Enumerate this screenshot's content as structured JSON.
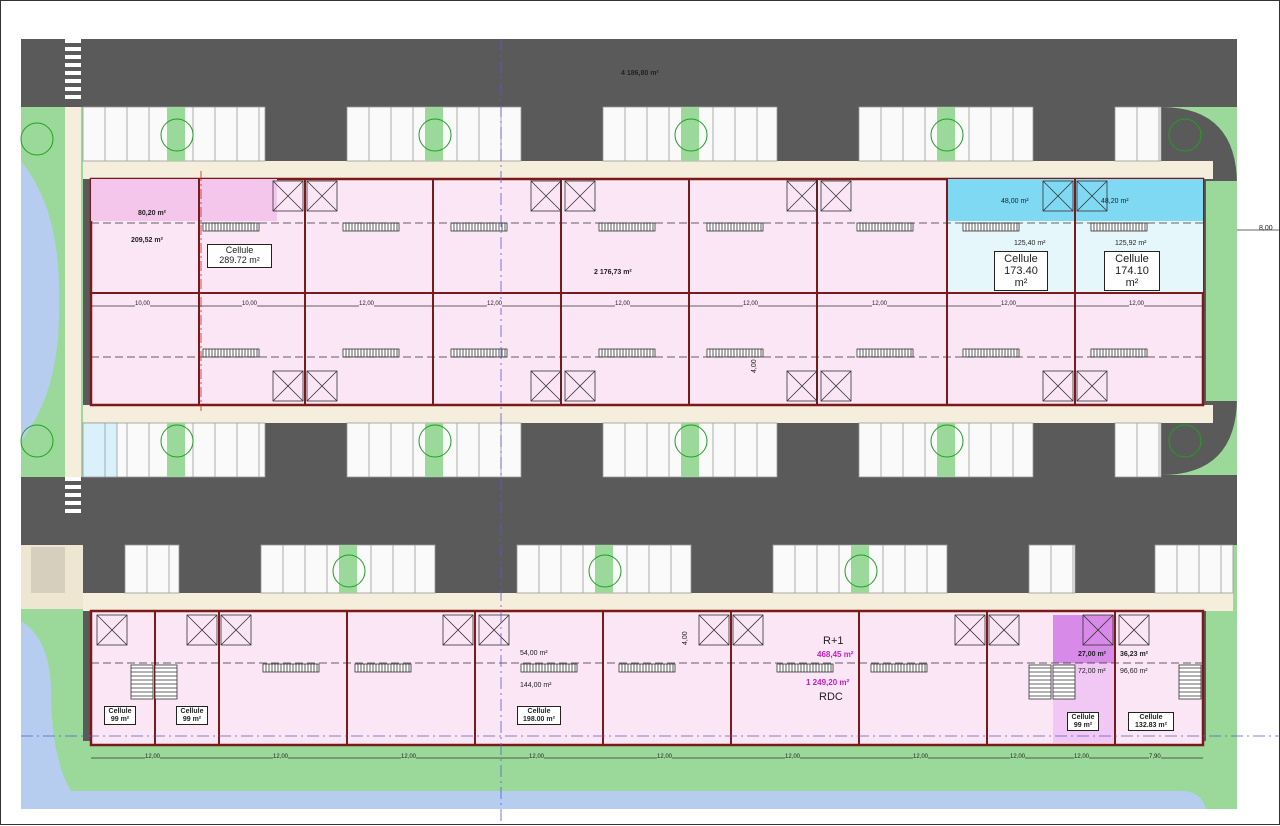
{
  "total_area": "4 186,80 m²",
  "block1": {
    "area_80": "80,20 m²",
    "area_209": "209,52 m²",
    "cell_a": {
      "label": "Cellule",
      "area": "289.72 m²"
    },
    "area_2176": "2 176,73 m²",
    "cell_b": {
      "upper": "48,00 m²",
      "ground": "125,40 m²",
      "label": "Cellule",
      "area": "173.40 m²"
    },
    "cell_c": {
      "upper": "48,20 m²",
      "ground": "125,92 m²",
      "label": "Cellule",
      "area": "174.10 m²"
    },
    "dims": [
      "10,00",
      "10,00",
      "12,00",
      "12,00",
      "12,00",
      "12,00",
      "12,00",
      "12,00",
      "12,00"
    ],
    "side_dim": "8,00",
    "stair_dim": "4,00"
  },
  "block2": {
    "cell_1": {
      "label": "Cellule",
      "area": "99 m²"
    },
    "cell_2": {
      "label": "Cellule",
      "area": "99 m²"
    },
    "area_54": "54,00 m²",
    "area_144": "144,00 m²",
    "cell_3": {
      "label": "Cellule",
      "area": "198.00 m²"
    },
    "r1_label": "R+1",
    "r1_area": "468,45 m²",
    "rdc_area": "1 249,20 m²",
    "rdc_label": "RDC",
    "area_27": "27,00 m²",
    "area_72": "72,00 m²",
    "area_36": "36,23 m²",
    "area_96": "96,60 m²",
    "cell_4": {
      "label": "Cellule",
      "area": "99 m²"
    },
    "cell_5": {
      "label": "Cellule",
      "area": "132.83 m²"
    },
    "dims": [
      "12,00",
      "12,00",
      "12,00",
      "12,00",
      "12,00",
      "12,00",
      "12,00",
      "12,00",
      "12,00",
      "7,90"
    ],
    "stair_dim": "4,00"
  },
  "colors": {
    "road": "#5a5a5a",
    "grass": "#9ad99a",
    "water": "#b7cdf0",
    "cell_fill": "#fbe6f6",
    "cell_hi": "#f4c6ec",
    "cyan": "#7fd9f3",
    "light_cyan": "#e6f7fb",
    "magenta": "#d88ae8",
    "wall": "#7a1a1a",
    "parking_bg": "#fafafa"
  }
}
